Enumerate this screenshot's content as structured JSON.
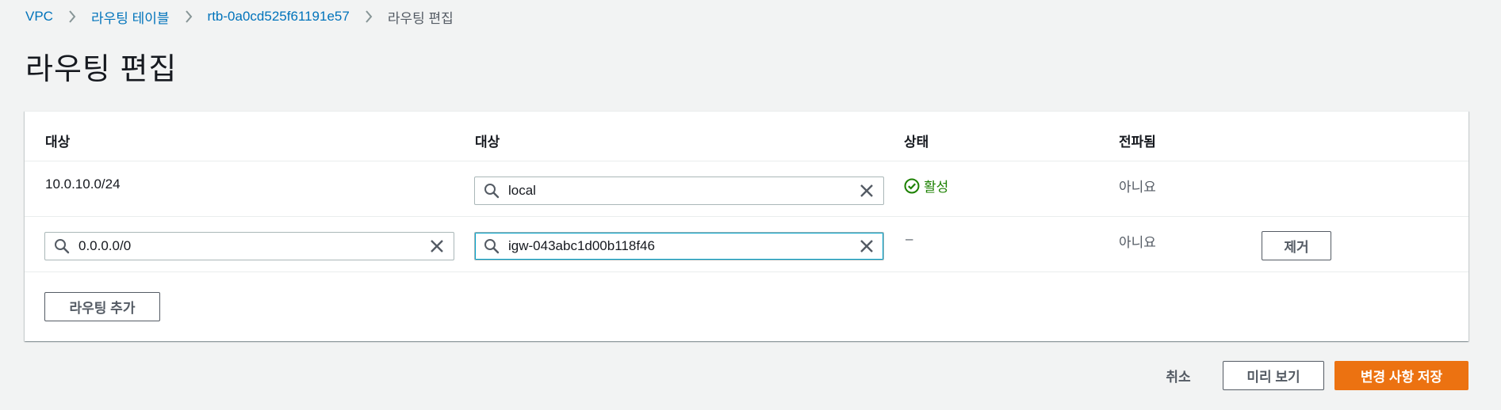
{
  "breadcrumb": {
    "items": [
      "VPC",
      "라우팅 테이블",
      "rtb-0a0cd525f61191e57"
    ],
    "current": "라우팅 편집"
  },
  "page_title": "라우팅 편집",
  "table": {
    "headers": {
      "destination": "대상",
      "target": "대상",
      "status": "상태",
      "propagated": "전파됨"
    },
    "rows": [
      {
        "destination": "10.0.10.0/24",
        "target": "local",
        "status": "활성",
        "propagated": "아니요"
      },
      {
        "destination": "0.0.0.0/0",
        "target": "igw-043abc1d00b118f46",
        "status": "–",
        "propagated": "아니요",
        "remove_label": "제거"
      }
    ],
    "add_route_label": "라우팅 추가"
  },
  "footer": {
    "cancel_label": "취소",
    "preview_label": "미리 보기",
    "save_label": "변경 사항 저장"
  },
  "colors": {
    "link": "#0073bb",
    "primary": "#ec7211",
    "success": "#1d8102",
    "background": "#f2f3f3"
  },
  "icons": {
    "breadcrumb_separator": "chevron-right-icon",
    "search": "search-icon",
    "clear": "close-icon",
    "status_ok": "check-circle-icon"
  }
}
